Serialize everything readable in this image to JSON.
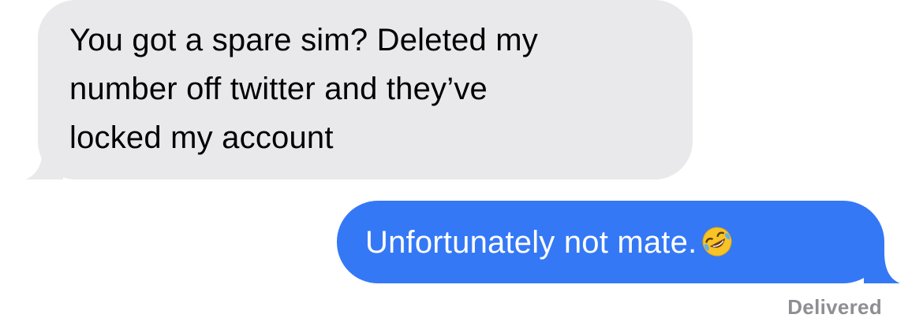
{
  "conversation": {
    "received_message": {
      "lines": [
        "You got a spare sim? Deleted my",
        "number off twitter and they’ve",
        "locked my account"
      ]
    },
    "sent_message": {
      "text": "Unfortunately not mate.",
      "emoji": "rolling-on-floor-laughing-emoji"
    },
    "status": "Delivered"
  },
  "colors": {
    "received_bubble": "#e9e9eb",
    "sent_bubble": "#3478f6",
    "received_text": "#000000",
    "sent_text": "#ffffff",
    "status_text": "#8e8e93"
  }
}
